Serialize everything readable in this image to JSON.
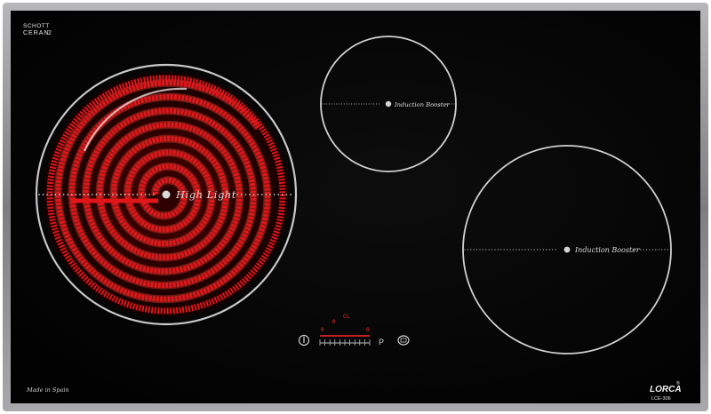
{
  "brand": {
    "glass_line1": "SCHOTT",
    "glass_line2": "CERAN",
    "maker_logo": "LORCA",
    "model": "LCE-306"
  },
  "footer": {
    "origin": "Made in Spain"
  },
  "zones": [
    {
      "id": "highlight",
      "label": "High Light"
    },
    {
      "id": "induction-small",
      "label": "Induction Booster"
    },
    {
      "id": "induction-large",
      "label": "Induction Booster"
    }
  ],
  "controls": {
    "display_segments": [
      "0",
      "0",
      "L",
      "0"
    ],
    "pause_label": "P",
    "power_icon": "power-icon",
    "lock_icon": "lock-icon"
  },
  "colors": {
    "frame": "#8f8f93",
    "glass": "#050505",
    "heater": "#e0161a",
    "ring": "#cfcfcf",
    "display": "#ff2a2a"
  }
}
